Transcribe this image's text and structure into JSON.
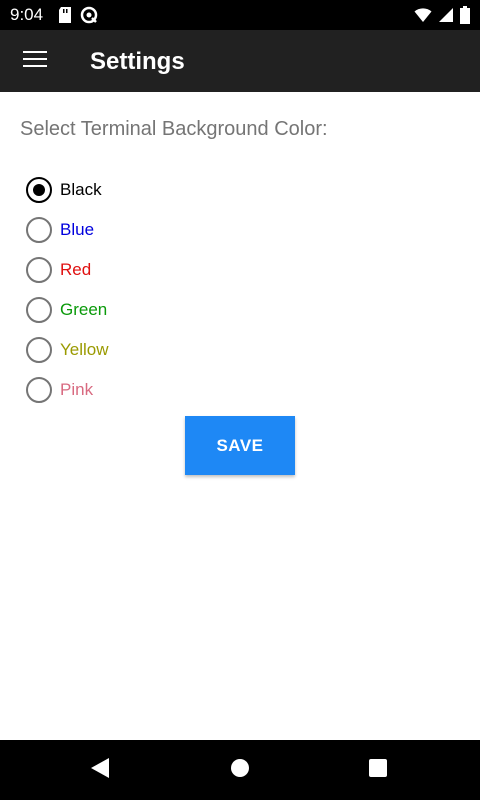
{
  "status_bar": {
    "time": "9:04",
    "left_icons": [
      "sd-card-icon",
      "sync-icon"
    ],
    "right_icons": [
      "wifi-icon",
      "cellular-signal-icon",
      "battery-icon"
    ]
  },
  "app_bar": {
    "menu_icon": "hamburger-menu-icon",
    "title": "Settings"
  },
  "main": {
    "prompt": "Select Terminal Background Color:",
    "options": [
      {
        "label": "Black",
        "color": "#000000",
        "selected": true
      },
      {
        "label": "Blue",
        "color": "#0000dd",
        "selected": false
      },
      {
        "label": "Red",
        "color": "#e01010",
        "selected": false
      },
      {
        "label": "Green",
        "color": "#0a9a0a",
        "selected": false
      },
      {
        "label": "Yellow",
        "color": "#9a9a00",
        "selected": false
      },
      {
        "label": "Pink",
        "color": "#d86a80",
        "selected": false
      }
    ],
    "save_label": "SAVE"
  },
  "nav_bar": {
    "icons": [
      "back-icon",
      "home-icon",
      "recents-icon"
    ]
  },
  "colors": {
    "accent": "#1e88f5",
    "app_bar": "#212121",
    "prompt_text": "#757575"
  }
}
